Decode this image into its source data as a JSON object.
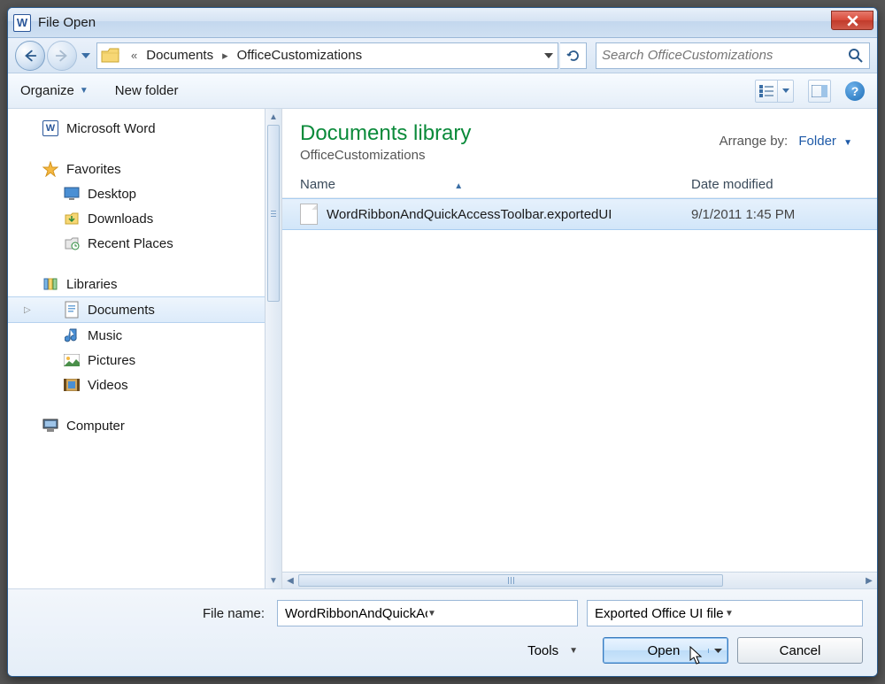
{
  "window": {
    "title": "File Open"
  },
  "breadcrumb": {
    "prefix": "«",
    "part1": "Documents",
    "part2": "OfficeCustomizations"
  },
  "search": {
    "placeholder": "Search OfficeCustomizations"
  },
  "toolbar": {
    "organize": "Organize",
    "newfolder": "New folder"
  },
  "sidebar": {
    "msword": "Microsoft Word",
    "favorites": {
      "header": "Favorites",
      "desktop": "Desktop",
      "downloads": "Downloads",
      "recent": "Recent Places"
    },
    "libraries": {
      "header": "Libraries",
      "documents": "Documents",
      "music": "Music",
      "pictures": "Pictures",
      "videos": "Videos"
    },
    "computer": "Computer"
  },
  "library": {
    "title": "Documents library",
    "subtitle": "OfficeCustomizations",
    "arrange_label": "Arrange by:",
    "arrange_value": "Folder"
  },
  "columns": {
    "name": "Name",
    "date": "Date modified"
  },
  "file": {
    "name": "WordRibbonAndQuickAccessToolbar.exportedUI",
    "date": "9/1/2011 1:45 PM"
  },
  "footer": {
    "filename_label": "File name:",
    "filename_value": "WordRibbonAndQuickAccessTool",
    "filter": "Exported Office UI file (*.exporte",
    "tools": "Tools",
    "open": "Open",
    "cancel": "Cancel"
  }
}
